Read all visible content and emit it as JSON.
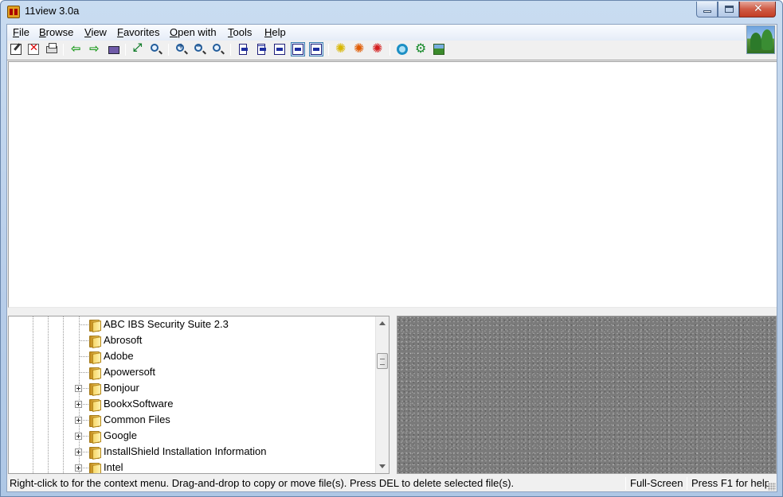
{
  "window": {
    "title": "11view 3.0a"
  },
  "menu": {
    "items": [
      {
        "label": "File"
      },
      {
        "label": "Browse"
      },
      {
        "label": "View"
      },
      {
        "label": "Favorites"
      },
      {
        "label": "Open with"
      },
      {
        "label": "Tools"
      },
      {
        "label": "Help"
      }
    ]
  },
  "toolbar": {
    "buttons": [
      {
        "icon": "edit-icon"
      },
      {
        "icon": "delete-icon"
      },
      {
        "icon": "print-icon"
      },
      {
        "icon": "arrow-left-icon"
      },
      {
        "icon": "arrow-right-icon"
      },
      {
        "icon": "slideshow-icon"
      },
      {
        "icon": "fit-to-window-icon"
      },
      {
        "icon": "zoom-find-icon"
      },
      {
        "icon": "zoom-in-icon"
      },
      {
        "icon": "zoom-out-icon"
      },
      {
        "icon": "zoom-actual-icon"
      },
      {
        "icon": "layout-icon"
      },
      {
        "icon": "layout-icon"
      },
      {
        "icon": "layout-icon"
      },
      {
        "icon": "layout-icon"
      },
      {
        "icon": "layout-icon"
      },
      {
        "icon": "brightness-icon"
      },
      {
        "icon": "color-adjust-icon"
      },
      {
        "icon": "remove-red-eye-icon"
      },
      {
        "icon": "settings-icon"
      },
      {
        "icon": "plugins-icon"
      },
      {
        "icon": "wallpaper-icon"
      }
    ]
  },
  "tree": {
    "folders": [
      {
        "label": "ABC IBS Security Suite 2.3",
        "expandable": false
      },
      {
        "label": "Abrosoft",
        "expandable": false
      },
      {
        "label": "Adobe",
        "expandable": false
      },
      {
        "label": "Apowersoft",
        "expandable": false
      },
      {
        "label": "Bonjour",
        "expandable": true
      },
      {
        "label": "BookxSoftware",
        "expandable": true
      },
      {
        "label": "Common Files",
        "expandable": true
      },
      {
        "label": "Google",
        "expandable": true
      },
      {
        "label": "InstallShield Installation Information",
        "expandable": true
      },
      {
        "label": "Intel",
        "expandable": true
      }
    ]
  },
  "status": {
    "hint": "Right-click to for the context menu. Drag-and-drop to copy or move file(s).  Press DEL to delete selected file(s).",
    "fullscreen": "Full-Screen",
    "help": "Press F1 for help"
  },
  "colors": {
    "title_gradient": "#c9dcf1",
    "preview_bg": "#7a7a7a",
    "folder": "#f7d46c"
  }
}
